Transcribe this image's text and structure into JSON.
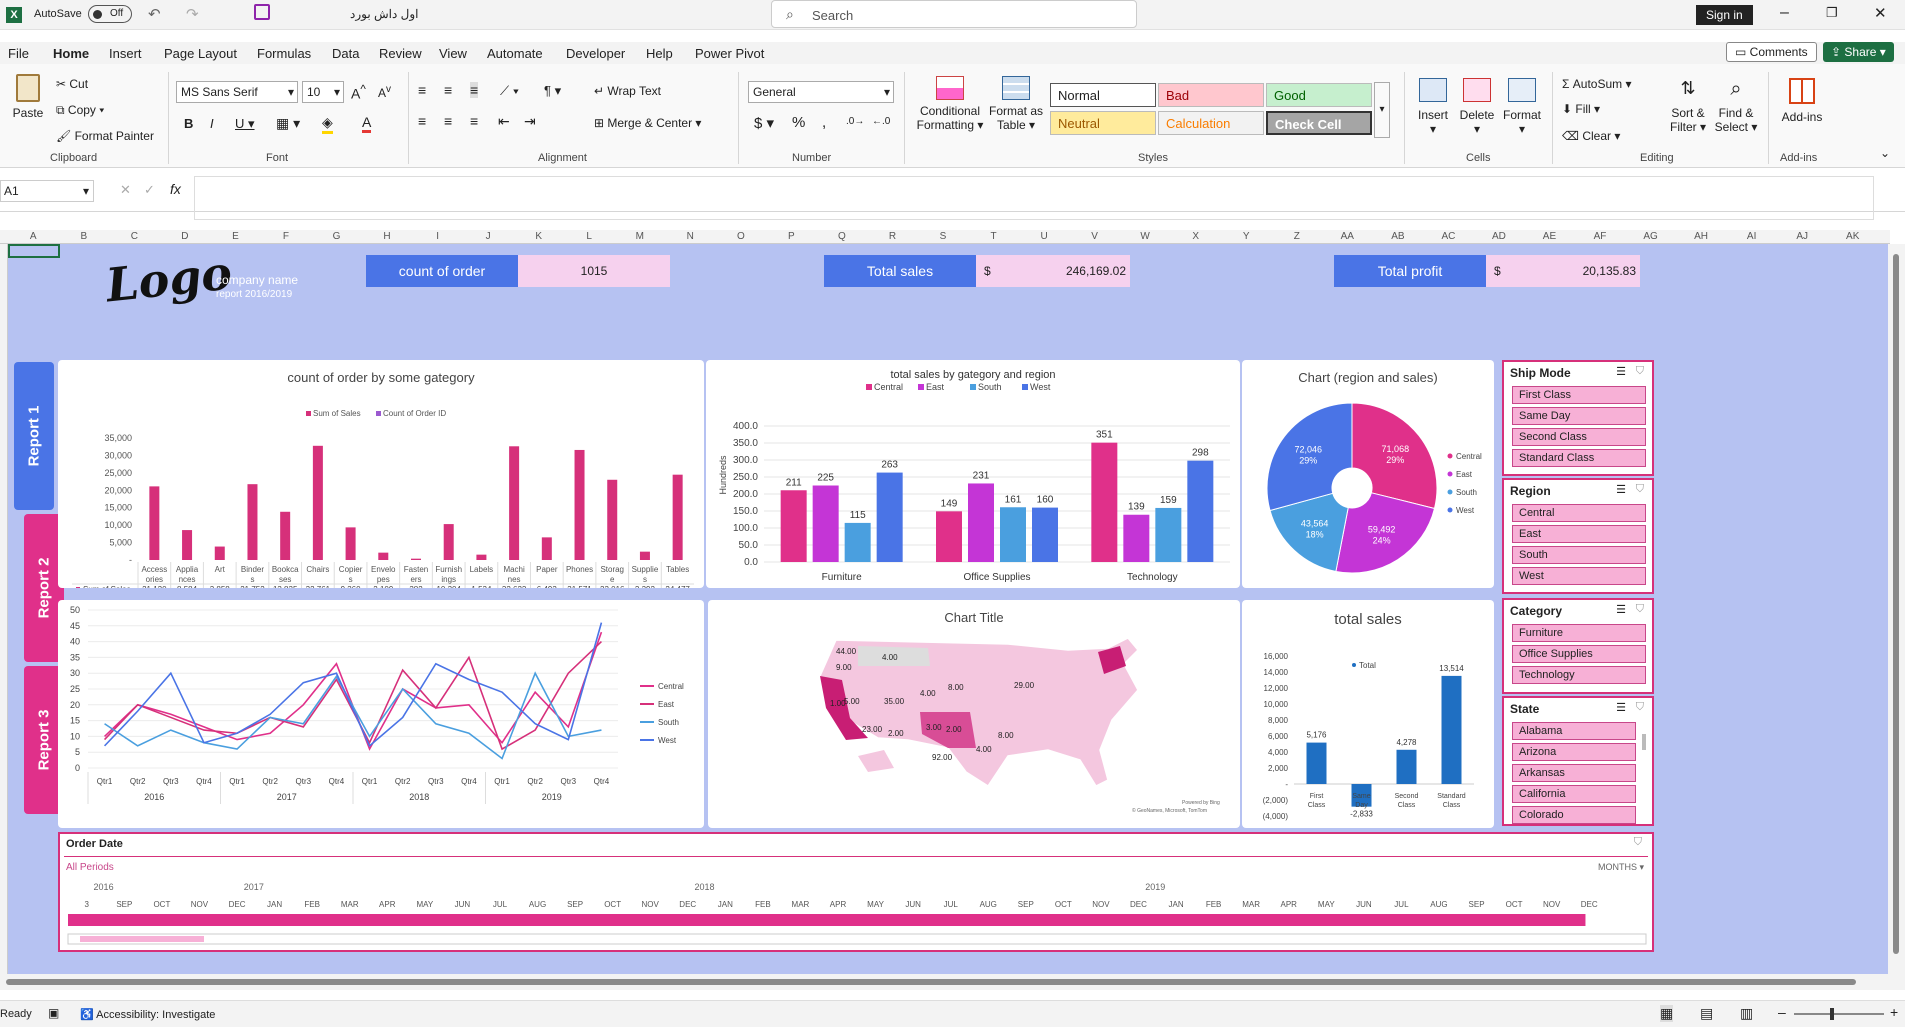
{
  "titlebar": {
    "autosave": "AutoSave",
    "autosave_state": "Off",
    "filename": "اول داش بورد",
    "search": "Search",
    "signin": "Sign in"
  },
  "menu": [
    "File",
    "Home",
    "Insert",
    "Page Layout",
    "Formulas",
    "Data",
    "Review",
    "View",
    "Automate",
    "Developer",
    "Help",
    "Power Pivot"
  ],
  "comments": "Comments",
  "share": "Share",
  "ribbon": {
    "paste": "Paste",
    "cut": "Cut",
    "copy": "Copy",
    "format_painter": "Format Painter",
    "font_name": "MS Sans Serif",
    "font_size": "10",
    "wrap": "Wrap Text",
    "merge": "Merge & Center",
    "number_format": "General",
    "cond_format": "Conditional",
    "cond_format2": "Formatting",
    "format_table": "Format as",
    "format_table2": "Table",
    "styles": [
      "Normal",
      "Bad",
      "Good",
      "Neutral",
      "Calculation",
      "Check Cell"
    ],
    "insert": "Insert",
    "delete": "Delete",
    "format": "Format",
    "autosum": "AutoSum",
    "fill": "Fill",
    "clear": "Clear",
    "sort": "Sort &",
    "sort2": "Filter",
    "find": "Find &",
    "find2": "Select",
    "addins": "Add-ins",
    "groups": [
      "Clipboard",
      "Font",
      "Alignment",
      "Number",
      "Styles",
      "Cells",
      "Editing",
      "Add-ins"
    ]
  },
  "namebox": "A1",
  "columns": [
    "A",
    "B",
    "C",
    "D",
    "E",
    "F",
    "G",
    "H",
    "I",
    "J",
    "K",
    "L",
    "M",
    "N",
    "O",
    "P",
    "Q",
    "R",
    "S",
    "T",
    "U",
    "V",
    "W",
    "X",
    "Y",
    "Z",
    "AA",
    "AB",
    "AC",
    "AD",
    "AE",
    "AF",
    "AG",
    "AH",
    "AI",
    "AJ",
    "AK"
  ],
  "dashboard": {
    "logo": "Logo",
    "company": "company name",
    "report_years": "report 2016/2019",
    "kpis": [
      {
        "label": "count of order",
        "value": "1015"
      },
      {
        "label": "Total sales",
        "currency": "$",
        "value": "246,169.02"
      },
      {
        "label": "Total profit",
        "currency": "$",
        "value": "20,135.83"
      }
    ],
    "reports": [
      "Report 1",
      "Report 2",
      "Report 3"
    ]
  },
  "chart_data": [
    {
      "type": "bar",
      "title": "count of order by some gategory",
      "categories": [
        "Access ories",
        "Applia nces",
        "Art",
        "Binder s",
        "Bookca ses",
        "Chairs",
        "Copier s",
        "Envelo pes",
        "Fasten ers",
        "Furnish ings",
        "Labels",
        "Machi nes",
        "Paper",
        "Phones",
        "Storag e",
        "Supplie s",
        "Tables"
      ],
      "series": [
        {
          "name": "Sum of Sales",
          "values": [
            21120,
            8584,
            3858,
            21752,
            13835,
            32761,
            9360,
            2109,
            382,
            10304,
            1534,
            32622,
            6493,
            31571,
            23016,
            2392,
            24477
          ]
        },
        {
          "name": "Count of Order ID",
          "values": [
            86,
            44,
            81,
            147,
            21,
            59,
            6,
            30,
            21,
            96,
            41,
            13,
            130,
            90,
            97,
            20,
            33
          ]
        }
      ],
      "table_rows": [
        {
          "label": "Sum of Sales",
          "values": [
            "21,120",
            "8,584",
            "3,858",
            "21,752",
            "13,835",
            "32,761",
            "9,360",
            "2,109",
            "382",
            "10,304",
            "1,534",
            "32,622",
            "6,493",
            "31,571",
            "23,016",
            "2,392",
            "24,477"
          ]
        },
        {
          "label": "Count of Order ID",
          "values": [
            "86",
            "44",
            "81",
            "147",
            "21",
            "59",
            "6",
            "30",
            "21",
            "96",
            "41",
            "13",
            "130",
            "90",
            "97",
            "20",
            "33"
          ]
        }
      ],
      "yticks": [
        "35,000",
        "30,000",
        "25,000",
        "20,000",
        "15,000",
        "10,000",
        "5,000",
        "-"
      ],
      "ylim": [
        0,
        35000
      ],
      "colors": [
        "#d6307a",
        "#9b59d0"
      ]
    },
    {
      "type": "bar",
      "title": "total sales by gategory and  region",
      "ylabel": "Hundreds",
      "categories": [
        "Furniture",
        "Office Supplies",
        "Technology"
      ],
      "series": [
        {
          "name": "Central",
          "values": [
            211,
            149,
            351
          ]
        },
        {
          "name": "East",
          "values": [
            225,
            231,
            139
          ]
        },
        {
          "name": "South",
          "values": [
            115,
            161,
            159
          ]
        },
        {
          "name": "West",
          "values": [
            263,
            160,
            298
          ]
        }
      ],
      "yticks": [
        "400.0",
        "350.0",
        "300.0",
        "250.0",
        "200.0",
        "150.0",
        "100.0",
        "50.0",
        "0.0"
      ],
      "ylim": [
        0,
        400
      ],
      "colors": [
        "#e0308a",
        "#c435d6",
        "#4a9fdf",
        "#4a74e6"
      ]
    },
    {
      "type": "pie",
      "title": "Chart (region and sales)",
      "labels": [
        "Central",
        "East",
        "South",
        "West"
      ],
      "values": [
        71068,
        59492,
        43564,
        72046
      ],
      "value_labels": [
        "71,068",
        "59,492",
        "43,564",
        "72,046"
      ],
      "pct": [
        "29%",
        "24%",
        "18%",
        "29%"
      ],
      "colors": [
        "#e0308a",
        "#c435d6",
        "#4a9fdf",
        "#4a74e6"
      ]
    },
    {
      "type": "line",
      "years": [
        "2016",
        "2017",
        "2018",
        "2019"
      ],
      "quarters": [
        "Qtr1",
        "Qtr2",
        "Qtr3",
        "Qtr4"
      ],
      "yticks": [
        "50",
        "45",
        "40",
        "35",
        "30",
        "25",
        "20",
        "15",
        "10",
        "5",
        "0"
      ],
      "ylim": [
        0,
        50
      ],
      "series": [
        {
          "name": "Central",
          "values": [
            10,
            20,
            17,
            13,
            9,
            11,
            20,
            33,
            6,
            25,
            19,
            20,
            8,
            24,
            13,
            43
          ]
        },
        {
          "name": "East",
          "values": [
            9,
            20,
            16,
            12,
            11,
            16,
            13,
            28,
            8,
            31,
            19,
            35,
            6,
            12,
            30,
            40
          ]
        },
        {
          "name": "South",
          "values": [
            14,
            7,
            12,
            8,
            6,
            16,
            14,
            29,
            10,
            25,
            14,
            11,
            3,
            30,
            10,
            12
          ]
        },
        {
          "name": "West",
          "values": [
            7,
            18,
            30,
            8,
            11,
            17,
            27,
            30,
            7,
            16,
            33,
            28,
            24,
            14,
            9,
            46
          ]
        }
      ],
      "colors": [
        "#e0308a",
        "#d6307a",
        "#4a9fdf",
        "#4a74e6"
      ]
    },
    {
      "type": "map",
      "title": "Chart Title",
      "labels": [
        "44.00",
        "9.00",
        "4.00",
        "1.00",
        "5.00",
        "35.00",
        "4.00",
        "8.00",
        "29.00",
        "23.00",
        "2.00",
        "3.00",
        "2.00",
        "92.00",
        "8.00",
        "4.00"
      ],
      "footer1": "Powered by Bing",
      "footer2": "© GeoNames, Microsoft, TomTom"
    },
    {
      "type": "bar",
      "title": "total sales",
      "legend": "Total",
      "categories": [
        "First Class",
        "Same Day",
        "Second Class",
        "Standard Class"
      ],
      "values": [
        5176,
        -2833,
        4278,
        13514
      ],
      "value_labels": [
        "5,176",
        "-2,833",
        "4,278",
        "13,514"
      ],
      "yticks": [
        "16,000",
        "14,000",
        "12,000",
        "10,000",
        "8,000",
        "6,000",
        "4,000",
        "2,000",
        "-",
        "(2,000)",
        "(4,000)"
      ],
      "ylim": [
        -4000,
        16000
      ],
      "color": "#1f6fc2"
    }
  ],
  "slicers": [
    {
      "title": "Ship Mode",
      "items": [
        "First Class",
        "Same Day",
        "Second Class",
        "Standard Class"
      ]
    },
    {
      "title": "Region",
      "items": [
        "Central",
        "East",
        "South",
        "West"
      ]
    },
    {
      "title": "Category",
      "items": [
        "Furniture",
        "Office Supplies",
        "Technology"
      ]
    },
    {
      "title": "State",
      "items": [
        "Alabama",
        "Arizona",
        "Arkansas",
        "California",
        "Colorado"
      ]
    }
  ],
  "timeline": {
    "title": "Order Date",
    "periods": "All Periods",
    "unit": "MONTHS",
    "years": [
      "2016",
      "2017",
      "2018",
      "2019"
    ],
    "months": [
      "3",
      "SEP",
      "OCT",
      "NOV",
      "DEC",
      "JAN",
      "FEB",
      "MAR",
      "APR",
      "MAY",
      "JUN",
      "JUL",
      "AUG",
      "SEP",
      "OCT",
      "NOV",
      "DEC",
      "JAN",
      "FEB",
      "MAR",
      "APR",
      "MAY",
      "JUN",
      "JUL",
      "AUG",
      "SEP",
      "OCT",
      "NOV",
      "DEC",
      "JAN",
      "FEB",
      "MAR",
      "APR",
      "MAY",
      "JUN",
      "JUL",
      "AUG",
      "SEP",
      "OCT",
      "NOV",
      "DEC"
    ]
  },
  "status": {
    "ready": "Ready",
    "accessibility": "Accessibility: Investigate"
  }
}
